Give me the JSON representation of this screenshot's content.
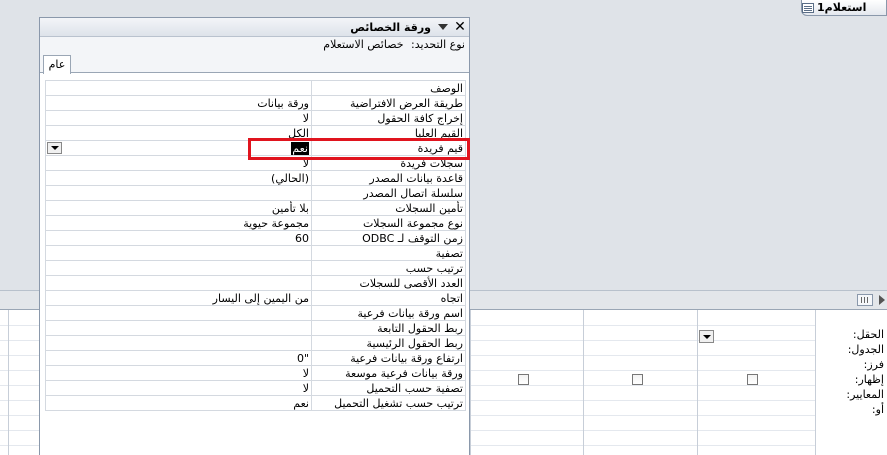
{
  "query_tab": {
    "title": "استعلام1"
  },
  "property_sheet": {
    "title": "ورقة الخصائص",
    "close_glyph": "✕",
    "selection_label": "نوع التحديد:",
    "selection_value": "خصائص الاستعلام",
    "tab_general": "عام",
    "rows": [
      {
        "name": "الوصف",
        "value": ""
      },
      {
        "name": "طريقة العرض الافتراضية",
        "value": "ورقة بيانات"
      },
      {
        "name": "إخراج كافة الحقول",
        "value": "لا"
      },
      {
        "name": "القيم العليا",
        "value": "الكل"
      },
      {
        "name": "قيم فريدة",
        "value": "نعم"
      },
      {
        "name": "سجلات فريدة",
        "value": "لا"
      },
      {
        "name": "قاعدة بيانات المصدر",
        "value": "(الحالي)"
      },
      {
        "name": "سلسلة اتصال المصدر",
        "value": ""
      },
      {
        "name": "تأمين السجلات",
        "value": "بلا تأمين"
      },
      {
        "name": "نوع مجموعة السجلات",
        "value": "مجموعة حيوية"
      },
      {
        "name": "زمن التوقف لـ ODBC",
        "value": "60"
      },
      {
        "name": "تصفية",
        "value": ""
      },
      {
        "name": "ترتيب حسب",
        "value": ""
      },
      {
        "name": "العدد الأقصى للسجلات",
        "value": ""
      },
      {
        "name": "اتجاه",
        "value": "من اليمين إلى اليسار"
      },
      {
        "name": "اسم ورقة بيانات فرعية",
        "value": ""
      },
      {
        "name": "ربط الحقول التابعة",
        "value": ""
      },
      {
        "name": "ربط الحقول الرئيسية",
        "value": ""
      },
      {
        "name": "ارتفاع ورقة بيانات فرعية",
        "value": "\"0"
      },
      {
        "name": "ورقة بيانات فرعية موسعة",
        "value": "لا"
      },
      {
        "name": "تصفية حسب التحميل",
        "value": "لا"
      },
      {
        "name": "ترتيب حسب تشغيل التحميل",
        "value": "نعم"
      }
    ]
  },
  "design_grid": {
    "labels": [
      "الحقل:",
      "الجدول:",
      "فرز:",
      "إظهار:",
      "المعايير:",
      "أو:"
    ]
  },
  "colors": {
    "highlight": "#e0141e",
    "background": "#dfe3e8"
  }
}
